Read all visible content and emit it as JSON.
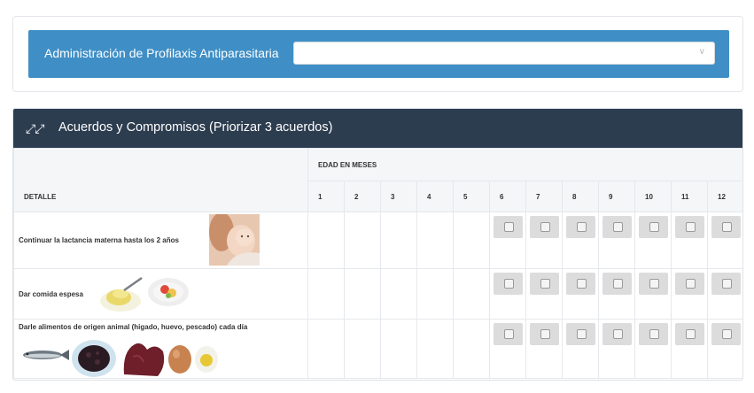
{
  "top": {
    "label": "Administración de Profilaxis Antiparasitaria",
    "select_value": "",
    "select_icon": "chevron-down-icon"
  },
  "panel": {
    "icon": "compress-icon",
    "title": "Acuerdos y Compromisos (Priorizar 3 acuerdos)"
  },
  "table": {
    "detail_header": "DETALLE",
    "age_header": "EDAD EN MESES",
    "months": [
      "1",
      "2",
      "3",
      "4",
      "5",
      "6",
      "7",
      "8",
      "9",
      "10",
      "11",
      "12"
    ],
    "rows": [
      {
        "text": "Continuar la lactancia materna hasta los 2 años",
        "images": [
          "mother-baby-photo"
        ]
      },
      {
        "text": "Dar comida espesa",
        "images": [
          "mashed-food-photo",
          "vegetable-plate-photo"
        ]
      },
      {
        "text": "Darle alimentos de origen animal (higado, huevo, pescado) cada día",
        "images": [
          "fish-photo",
          "blood-sausage-photo",
          "liver-photo",
          "egg-photo",
          "boiled-egg-photo"
        ]
      }
    ]
  },
  "colors": {
    "accent_blue": "#3f8fc6",
    "panel_header": "#2d3d50",
    "checkbox_bg": "#dcdcdc"
  }
}
